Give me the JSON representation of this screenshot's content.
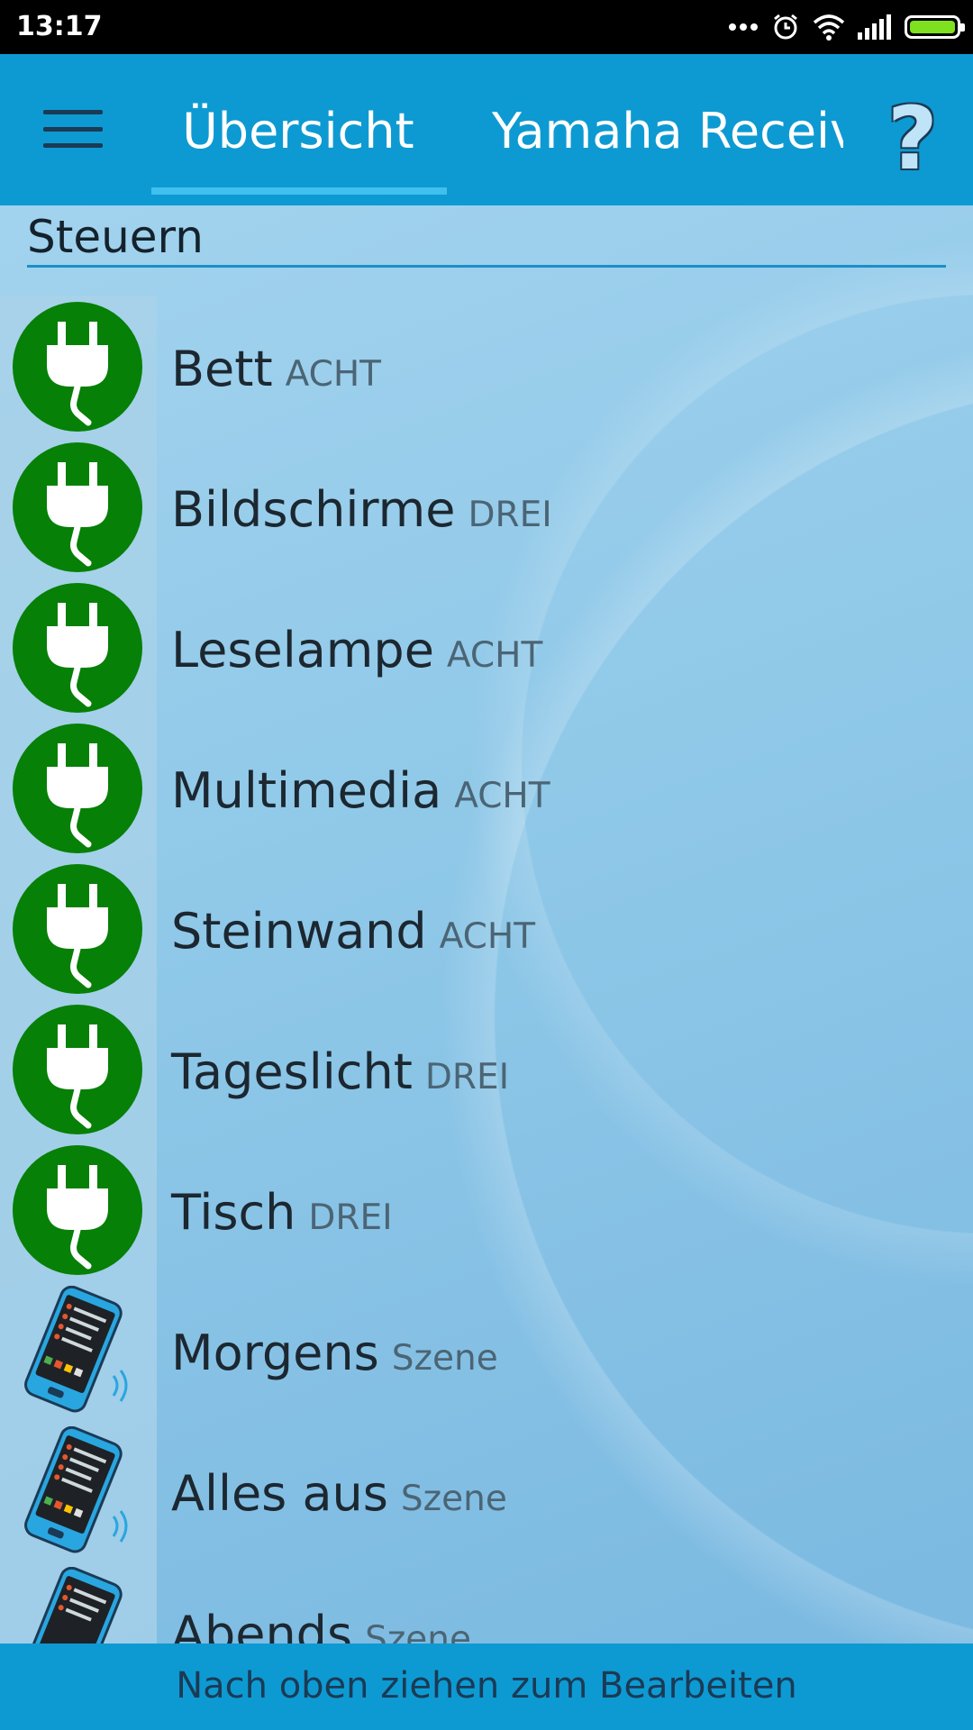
{
  "status_bar": {
    "time": "13:17",
    "icons": [
      "more-dots-icon",
      "alarm-icon",
      "wifi-icon",
      "signal-icon",
      "battery-icon"
    ]
  },
  "app_bar": {
    "tabs": [
      {
        "label": "Übersicht",
        "selected": true
      },
      {
        "label": "Yamaha Receiver",
        "selected": false
      }
    ],
    "help_label": "?",
    "accent_color": "#0d9ad2"
  },
  "section": {
    "title": "Steuern"
  },
  "items": [
    {
      "name": "Bett",
      "type": "ACHT",
      "icon": "plug-icon"
    },
    {
      "name": "Bildschirme",
      "type": "DREI",
      "icon": "plug-icon"
    },
    {
      "name": "Leselampe",
      "type": "ACHT",
      "icon": "plug-icon"
    },
    {
      "name": "Multimedia",
      "type": "ACHT",
      "icon": "plug-icon"
    },
    {
      "name": "Steinwand",
      "type": "ACHT",
      "icon": "plug-icon"
    },
    {
      "name": "Tageslicht",
      "type": "DREI",
      "icon": "plug-icon"
    },
    {
      "name": "Tisch",
      "type": "DREI",
      "icon": "plug-icon"
    },
    {
      "name": "Morgens",
      "type": "Szene",
      "icon": "phone-scene-icon"
    },
    {
      "name": "Alles aus",
      "type": "Szene",
      "icon": "phone-scene-icon"
    },
    {
      "name": "Abends",
      "type": "Szene",
      "icon": "phone-scene-icon"
    }
  ],
  "bottom_bar": {
    "hint": "Nach oben ziehen zum Bearbeiten"
  },
  "colors": {
    "plug_green": "#068006",
    "text_dark": "#1c2730"
  }
}
